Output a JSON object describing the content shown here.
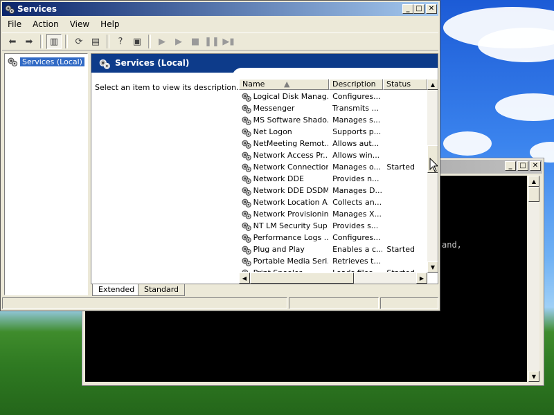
{
  "services_window": {
    "title": "Services",
    "menu": [
      "File",
      "Action",
      "View",
      "Help"
    ],
    "tree_item": "Services (Local)",
    "pane_title": "Services (Local)",
    "description": "Select an item to view its description.",
    "columns": [
      "Name",
      "Description",
      "Status"
    ],
    "rows": [
      {
        "name": "Logical Disk Manag...",
        "desc": "Configures...",
        "status": ""
      },
      {
        "name": "Messenger",
        "desc": "Transmits ...",
        "status": ""
      },
      {
        "name": "MS Software Shado...",
        "desc": "Manages s...",
        "status": ""
      },
      {
        "name": "Net Logon",
        "desc": "Supports p...",
        "status": ""
      },
      {
        "name": "NetMeeting Remot...",
        "desc": "Allows aut...",
        "status": ""
      },
      {
        "name": "Network Access Pr...",
        "desc": "Allows win...",
        "status": ""
      },
      {
        "name": "Network Connections",
        "desc": "Manages o...",
        "status": "Started"
      },
      {
        "name": "Network DDE",
        "desc": "Provides n...",
        "status": ""
      },
      {
        "name": "Network DDE DSDM",
        "desc": "Manages D...",
        "status": ""
      },
      {
        "name": "Network Location A...",
        "desc": "Collects an...",
        "status": ""
      },
      {
        "name": "Network Provisionin...",
        "desc": "Manages X...",
        "status": ""
      },
      {
        "name": "NT LM Security Sup...",
        "desc": "Provides s...",
        "status": ""
      },
      {
        "name": "Performance Logs ...",
        "desc": "Configures...",
        "status": ""
      },
      {
        "name": "Plug and Play",
        "desc": "Enables a c...",
        "status": "Started"
      },
      {
        "name": "Portable Media Seri...",
        "desc": "Retrieves t...",
        "status": ""
      },
      {
        "name": "Print Spooler",
        "desc": "Loads files ...",
        "status": "Started"
      }
    ],
    "tabs": [
      "Extended",
      "Standard"
    ],
    "colors": {
      "title_bar": "#0a246a",
      "selection": "#316ac5",
      "pane_header": "#0d3b8a"
    }
  },
  "console_window": {
    "visible_text": "and,"
  }
}
